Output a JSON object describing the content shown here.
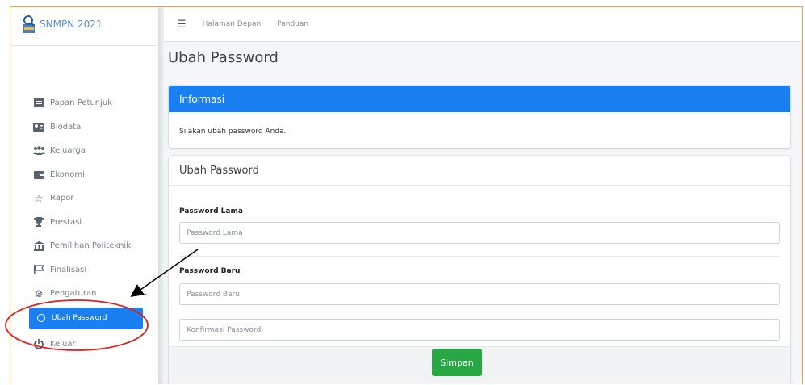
{
  "brand": {
    "title": "SNMPN 2021",
    "logo_text": "SNMPN"
  },
  "topbar": {
    "home": "Halaman Depan",
    "guide": "Panduan"
  },
  "sidebar": {
    "items": [
      {
        "label": "Papan Petunjuk",
        "icon": "dashboard-icon"
      },
      {
        "label": "Biodata",
        "icon": "id-card-icon"
      },
      {
        "label": "Keluarga",
        "icon": "users-icon"
      },
      {
        "label": "Ekonomi",
        "icon": "wallet-icon"
      },
      {
        "label": "Rapor",
        "icon": "star-outline-icon"
      },
      {
        "label": "Prestasi",
        "icon": "trophy-icon"
      },
      {
        "label": "Pemilihan Politeknik",
        "icon": "institution-icon"
      },
      {
        "label": "Finalisasi",
        "icon": "flag-icon"
      },
      {
        "label": "Pengaturan",
        "icon": "gear-icon"
      }
    ],
    "sub_item": {
      "label": "Ubah Password",
      "icon": "circle-outline-icon"
    },
    "logout": {
      "label": "Keluar",
      "icon": "power-icon"
    }
  },
  "page": {
    "title": "Ubah Password"
  },
  "info_card": {
    "header": "Informasi",
    "body": "Silakan ubah password Anda."
  },
  "form_card": {
    "header": "Ubah Password",
    "old_label": "Password Lama",
    "old_placeholder": "Password Lama",
    "new_label": "Password Baru",
    "new_placeholder": "Password Baru",
    "confirm_placeholder": "Konfirmasi Password",
    "submit": "Simpan"
  },
  "colors": {
    "primary": "#1a7ff0",
    "success": "#28a745",
    "annotation": "#e0201c"
  }
}
